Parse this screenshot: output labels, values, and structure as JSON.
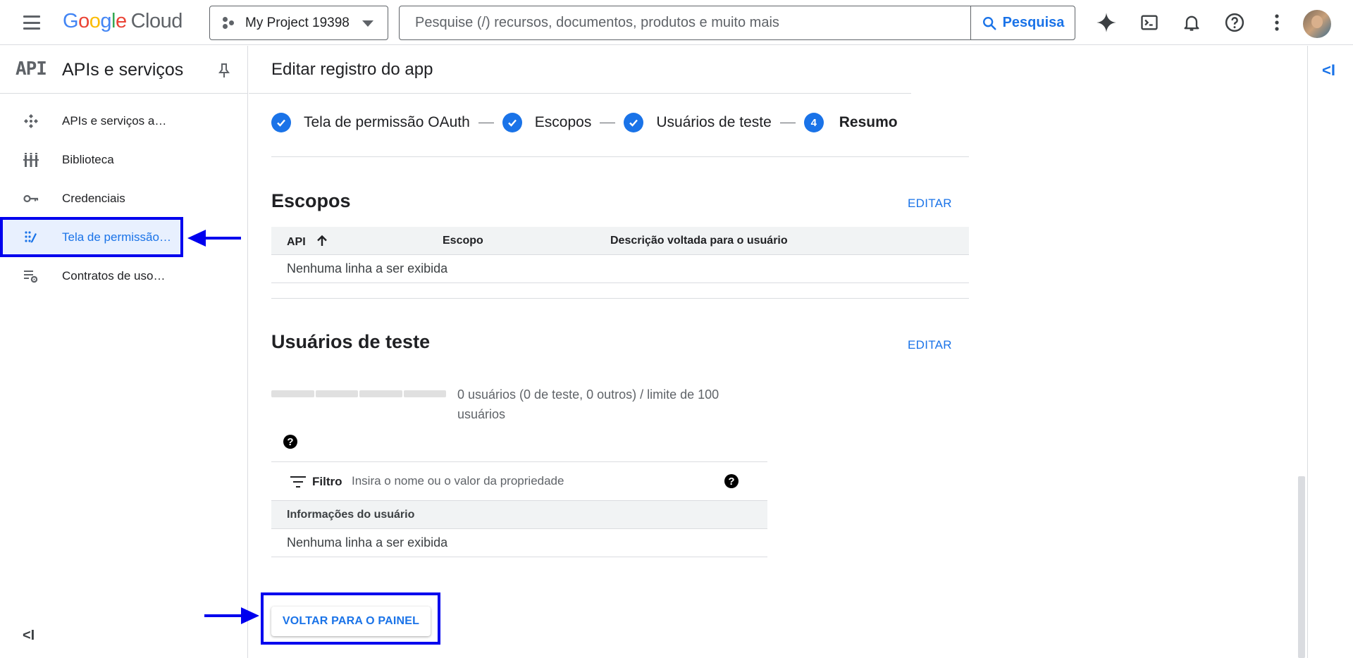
{
  "header": {
    "logo_letters": [
      "G",
      "o",
      "o",
      "g",
      "l",
      "e"
    ],
    "logo_product": "Cloud",
    "project_name": "My Project 19398",
    "search_placeholder": "Pesquise (/) recursos, documentos, produtos e muito mais",
    "search_button": "Pesquisa",
    "icons": [
      "gemini-icon",
      "cloud-shell-icon",
      "notifications-icon",
      "help-icon",
      "more-vert-icon",
      "avatar"
    ]
  },
  "sidebar": {
    "badge": "API",
    "title": "APIs e serviços",
    "items": [
      {
        "label": "APIs e serviços a…",
        "icon": "apis-icon"
      },
      {
        "label": "Biblioteca",
        "icon": "library-icon"
      },
      {
        "label": "Credenciais",
        "icon": "key-icon"
      },
      {
        "label": "Tela de permissão…",
        "icon": "consent-screen-icon",
        "active": true
      },
      {
        "label": "Contratos de uso…",
        "icon": "settings-list-icon"
      }
    ],
    "collapse": "<I"
  },
  "main": {
    "page_title": "Editar registro do app",
    "stepper": [
      {
        "label": "Tela de permissão OAuth",
        "done": true
      },
      {
        "label": "Escopos",
        "done": true
      },
      {
        "label": "Usuários de teste",
        "done": true
      },
      {
        "label": "Resumo",
        "number": "4",
        "current": true
      }
    ],
    "scopes": {
      "title": "Escopos",
      "edit": "EDITAR",
      "columns": [
        "API",
        "Escopo",
        "Descrição voltada para o usuário"
      ],
      "empty": "Nenhuma linha a ser exibida"
    },
    "test_users": {
      "title": "Usuários de teste",
      "edit": "EDITAR",
      "quota": "0 usuários (0 de teste, 0 outros) / limite de 100 usuários",
      "quota_fraction": 0,
      "filter_label": "Filtro",
      "filter_placeholder": "Insira o nome ou o valor da propriedade",
      "column": "Informações do usuário",
      "empty": "Nenhuma linha a ser exibida"
    },
    "back_button": "VOLTAR PARA O PAINEL"
  },
  "right_rail": {
    "collapse": "<I"
  },
  "colors": {
    "accent": "#1a73e8",
    "highlight": "#0000ee"
  }
}
